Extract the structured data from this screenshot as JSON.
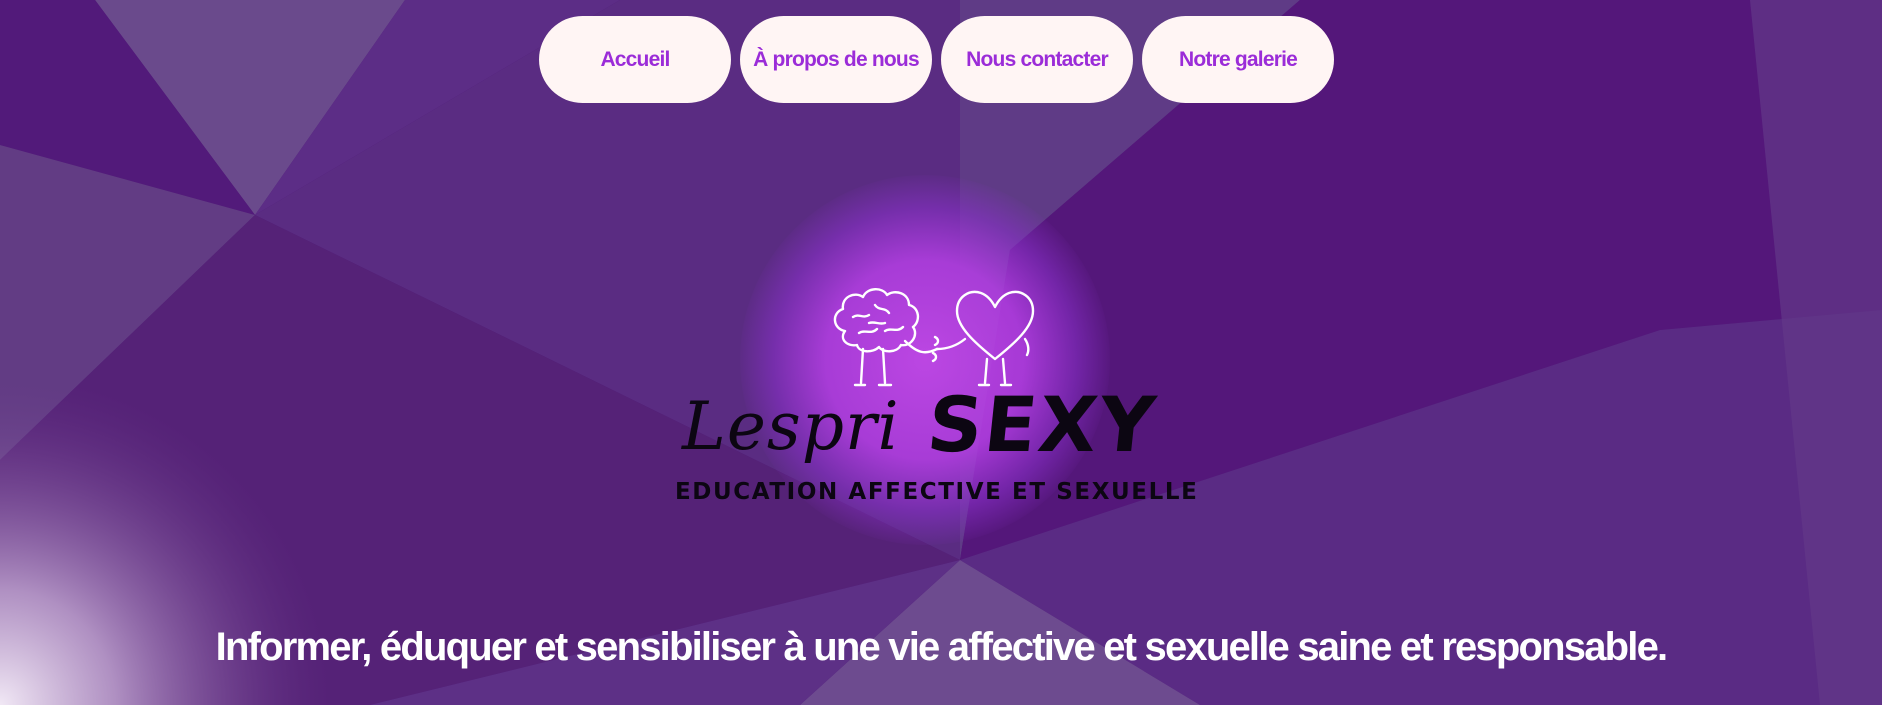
{
  "nav": {
    "items": [
      {
        "label": "Accueil"
      },
      {
        "label": "À propos de nous"
      },
      {
        "label": "Nous contacter"
      },
      {
        "label": "Notre galerie"
      }
    ]
  },
  "logo": {
    "script_text": "Lespri",
    "bold_text": "SEXY",
    "tagline": "EDUCATION AFFECTIVE ET SEXUELLE"
  },
  "hero": {
    "headline": "Informer, éduquer et sensibiliser à une vie affective et sexuelle saine et responsable."
  },
  "colors": {
    "background": "#4f1575",
    "nav_button_bg": "#fff5f4",
    "nav_text": "#9b2cd8",
    "glow": "#c148e8",
    "headline": "#ffffff"
  },
  "icons": [
    "brain-heart-mascot-icon"
  ]
}
